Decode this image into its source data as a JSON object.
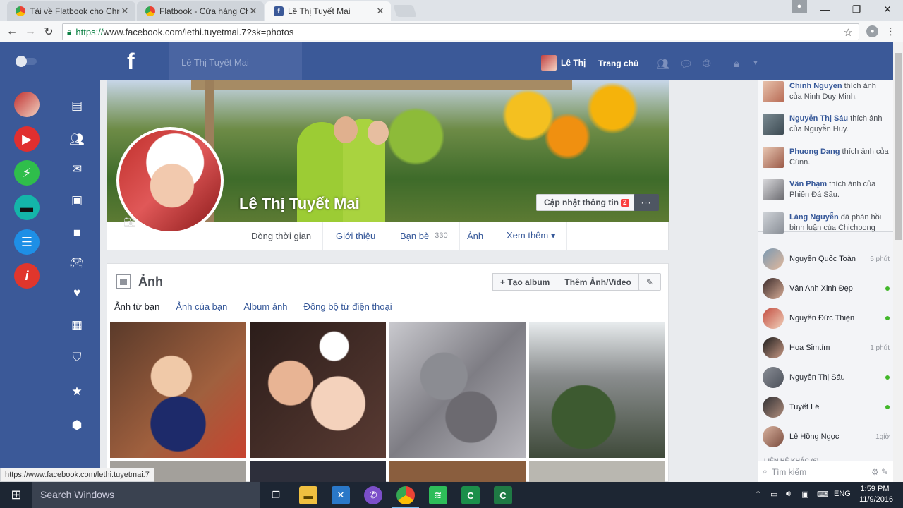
{
  "browser": {
    "tabs": [
      {
        "title": "Tải về Flatbook cho Chrc"
      },
      {
        "title": "Flatbook - Cửa hàng Chr"
      },
      {
        "title": "Lê Thị Tuyết Mai"
      }
    ],
    "url_protocol": "https://",
    "url_rest": "www.facebook.com/lethi.tuyetmai.7?sk=photos",
    "status_url": "https://www.facebook.com/lethi.tuyetmai.7"
  },
  "fb": {
    "logo": "f",
    "search_placeholder": "Lê Thị Tuyết Mai",
    "user_short": "Lê Thị",
    "home_label": "Trang chủ"
  },
  "profile": {
    "name": "Lê Thị Tuyết Mai",
    "update_label": "Cập nhật thông tin",
    "update_badge": "2",
    "more_label": "···"
  },
  "nav": {
    "timeline": "Dòng thời gian",
    "about": "Giới thiệu",
    "friends": "Bạn bè",
    "friends_count": "330",
    "photos": "Ảnh",
    "more": "Xem thêm ▾"
  },
  "photos": {
    "title": "Ảnh",
    "create_album": "+ Tạo album",
    "add_media": "Thêm Ảnh/Video",
    "subtabs": [
      "Ảnh từ bạn",
      "Ảnh của bạn",
      "Album ảnh",
      "Đồng bộ từ điện thoại"
    ]
  },
  "ticker": [
    {
      "name": "Chinh Nguyen",
      "text": " thích ảnh của Ninh Duy Minh."
    },
    {
      "name": "Nguyễn Thị Sáu",
      "text": " thích ảnh của Nguyễn Huy."
    },
    {
      "name": "Phuong Dang",
      "text": " thích ảnh của Cúnn."
    },
    {
      "name": "Vân Phạm",
      "text": " thích ảnh của Phiến Đá Sầu."
    },
    {
      "name": "Lăng Nguyễn",
      "text": " đã phản hồi bình luận của Chichbong"
    }
  ],
  "contacts": [
    {
      "name": "Nguyễn Quốc Toàn",
      "time": "5 phút"
    },
    {
      "name": "Vân Anh Xinh Đẹp",
      "time": ""
    },
    {
      "name": "Nguyễn Đức Thiện",
      "time": ""
    },
    {
      "name": "Hoa Simtím",
      "time": "1 phút"
    },
    {
      "name": "Nguyễn Thị Sáu",
      "time": ""
    },
    {
      "name": "Tuyết Lê",
      "time": ""
    },
    {
      "name": "Lê Hồng Ngọc",
      "time": "1giờ"
    }
  ],
  "chat": {
    "more_contacts": "LIÊN HỆ KHÁC (6)",
    "search_placeholder": "Tìm kiếm"
  },
  "taskbar": {
    "search": "Search Windows",
    "lang": "ENG",
    "time": "1:59 PM",
    "date": "11/9/2016"
  },
  "colors": {
    "fb_blue": "#3b5998",
    "link": "#365899",
    "online": "#42b72a",
    "badge": "#fa3e3e"
  }
}
